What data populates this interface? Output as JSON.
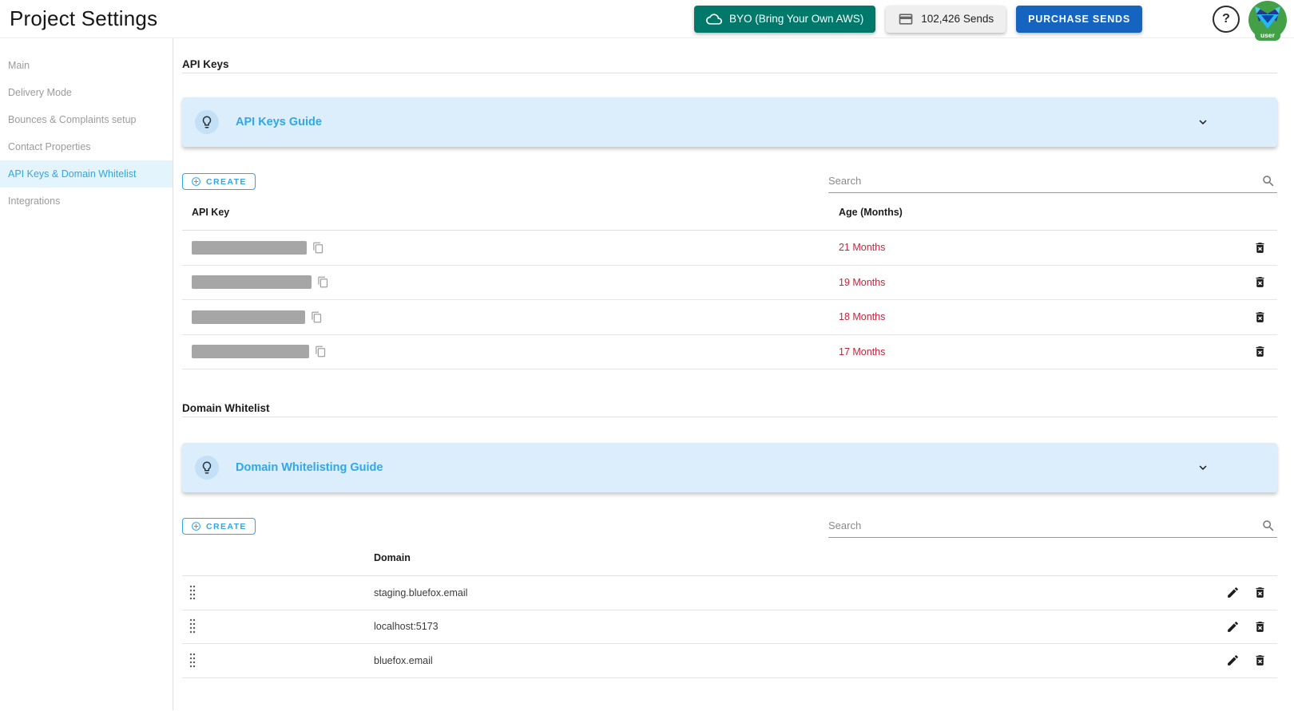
{
  "header": {
    "title": "Project Settings",
    "byo_button": "BYO (Bring Your Own AWS)",
    "sends_count": "102,426 Sends",
    "purchase_button": "PURCHASE SENDS",
    "help_label": "?",
    "avatar_badge": "user"
  },
  "sidebar": {
    "items": [
      {
        "label": "Main",
        "active": false
      },
      {
        "label": "Delivery Mode",
        "active": false
      },
      {
        "label": "Bounces & Complaints setup",
        "active": false
      },
      {
        "label": "Contact Properties",
        "active": false
      },
      {
        "label": "API Keys & Domain Whitelist",
        "active": true
      },
      {
        "label": "Integrations",
        "active": false
      }
    ]
  },
  "api_keys": {
    "section_title": "API Keys",
    "guide_title": "API Keys Guide",
    "create_label": "CREATE",
    "search_placeholder": "Search",
    "columns": {
      "key": "API Key",
      "age": "Age (Months)"
    },
    "rows": [
      {
        "key_redacted": true,
        "age": "21 Months"
      },
      {
        "key_redacted": true,
        "age": "19 Months"
      },
      {
        "key_redacted": true,
        "age": "18 Months"
      },
      {
        "key_redacted": true,
        "age": "17 Months"
      }
    ]
  },
  "domain_whitelist": {
    "section_title": "Domain Whitelist",
    "guide_title": "Domain Whitelisting Guide",
    "create_label": "CREATE",
    "search_placeholder": "Search",
    "columns": {
      "domain": "Domain"
    },
    "rows": [
      {
        "domain": "staging.bluefox.email"
      },
      {
        "domain": "localhost:5173"
      },
      {
        "domain": "bluefox.email"
      }
    ]
  },
  "colors": {
    "accent_blue": "#2fa7e9",
    "byo_teal": "#00796b",
    "purchase_blue": "#1565c0",
    "age_red": "#c1263c",
    "guide_banner_bg": "#dcedfb",
    "avatar_green": "#43a047",
    "sidebar_active_bg": "#e4f4fd"
  }
}
